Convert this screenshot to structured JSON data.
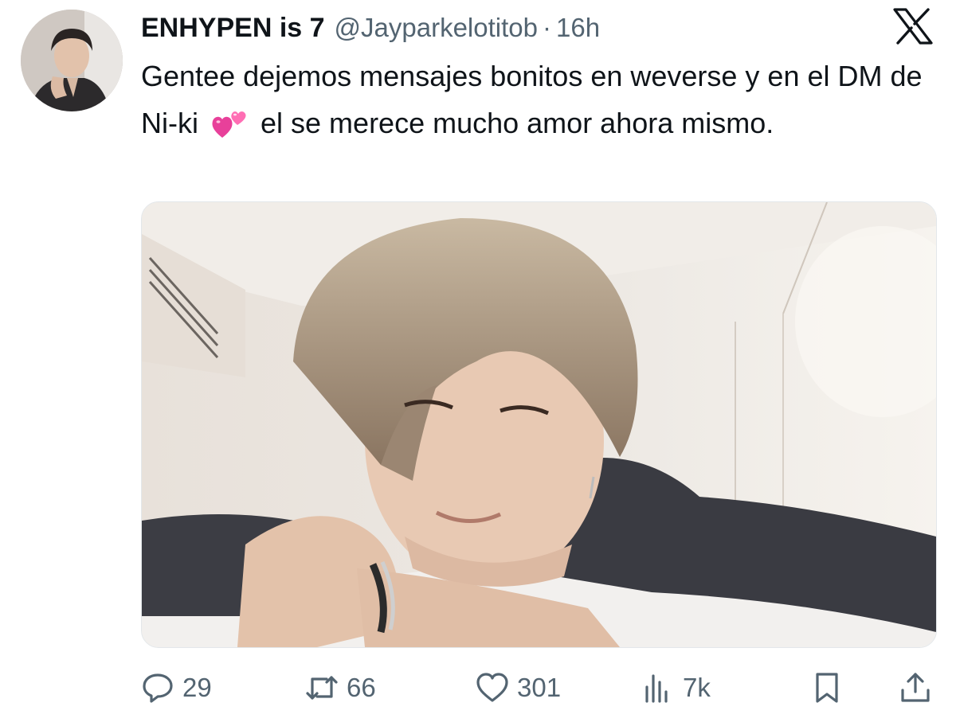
{
  "author": {
    "display_name": "ENHYPEN is 7",
    "handle": "@Jayparkelotitob",
    "separator": "·",
    "time": "16h",
    "avatar_icon": "profile-avatar"
  },
  "platform_logo": "x-logo-icon",
  "tweet": {
    "text_before_emoji": "Gentee dejemos mensajes bonitos en weverse y en el DM de Ni-ki",
    "emoji": "two-hearts-emoji",
    "text_after_emoji": "el se merece mucho amor ahora mismo."
  },
  "media": {
    "kind": "photo",
    "description_icon": "attached-photo"
  },
  "actions": {
    "replies": "29",
    "reposts": "66",
    "likes": "301",
    "views": "7k"
  },
  "colors": {
    "text": "#0f1419",
    "secondary": "#536471",
    "emoji_pink": "#e8409a"
  }
}
